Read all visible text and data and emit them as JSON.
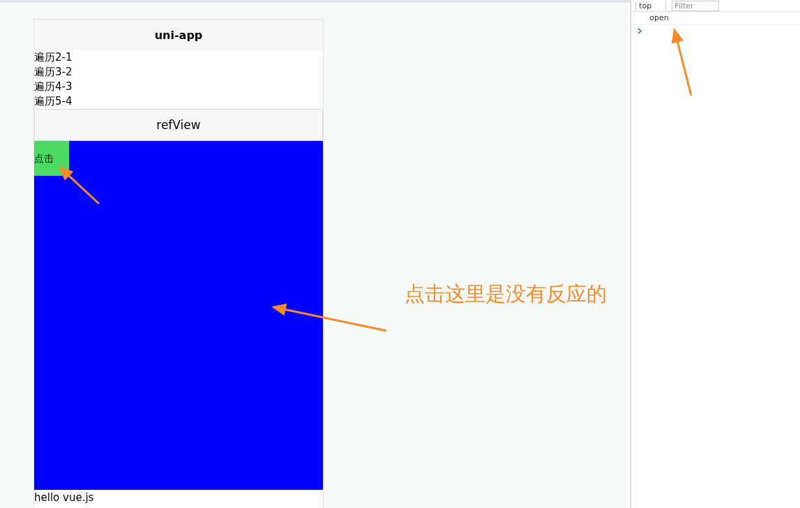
{
  "preview": {
    "nav_title": "uni-app",
    "list_items": [
      "遍历2-1",
      "遍历3-2",
      "遍历4-3",
      "遍历5-4"
    ],
    "ref_view": {
      "title": "refView",
      "button_label": "点击"
    },
    "footer_text": "hello vue.js"
  },
  "annotation": {
    "text": "点击这里是没有反应的"
  },
  "devtools": {
    "context": "top",
    "filter_placeholder": "Filter",
    "console_lines": [
      "open"
    ]
  }
}
